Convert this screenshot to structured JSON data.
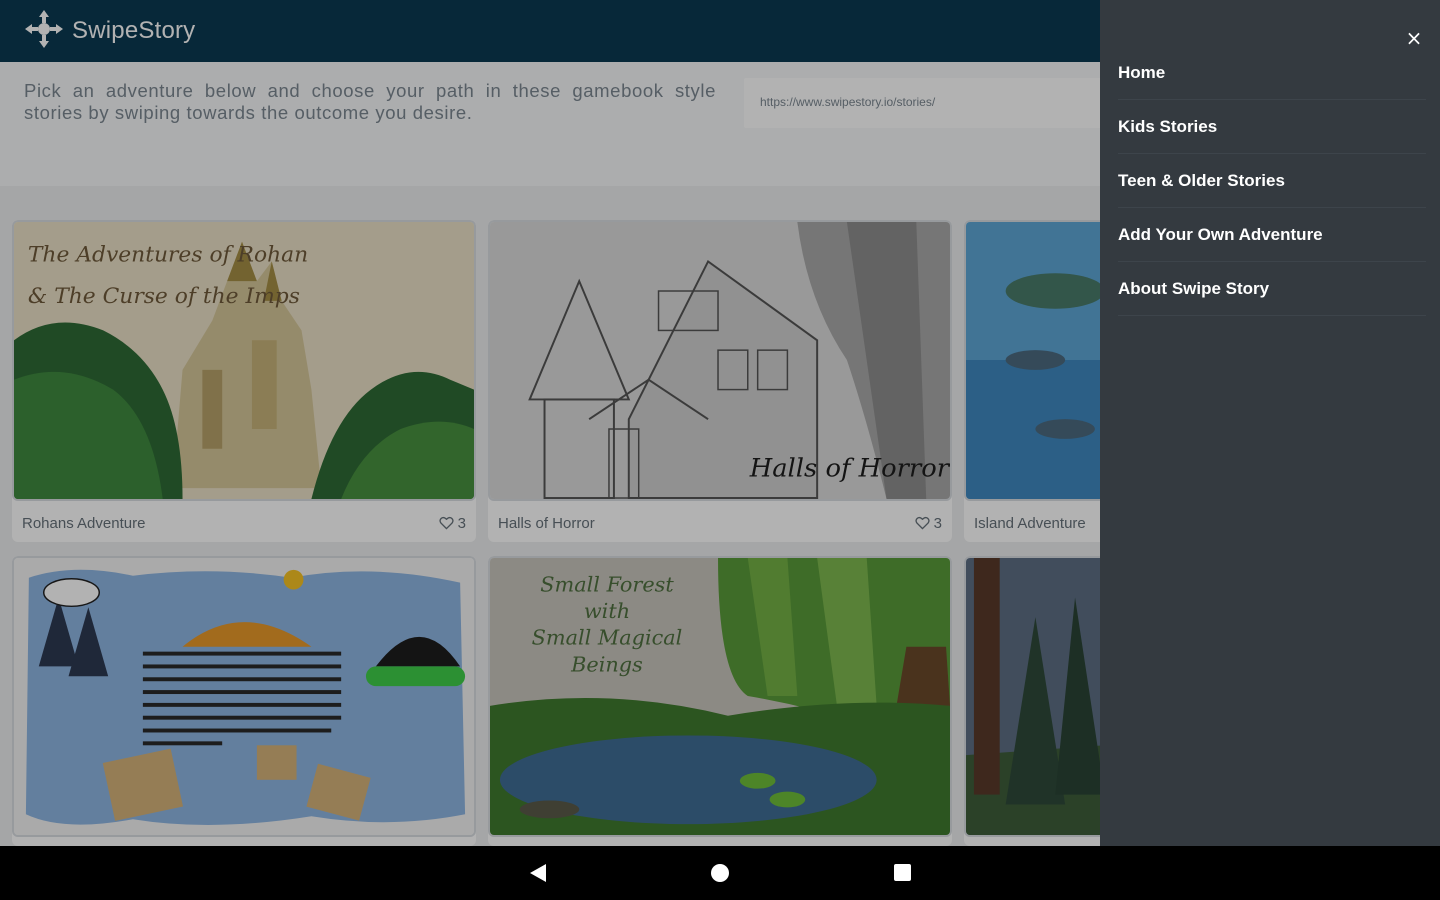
{
  "header": {
    "brand_name": "SwipeStory",
    "logo_icon": "four-arrows-cross-icon",
    "background": "#0b3a52"
  },
  "intro": {
    "description": "Pick an adventure below and choose your path in these gamebook style stories by swiping towards the outcome you desire.",
    "url": "https://www.swipestory.io/stories/"
  },
  "stories": [
    {
      "title": "Rohans Adventure",
      "likes": "3",
      "cover_text": [
        "The Adventures of Rohan",
        "& The Curse of the Imps"
      ]
    },
    {
      "title": "Halls of Horror",
      "likes": "3",
      "cover_text": [
        "Halls of Horror"
      ]
    },
    {
      "title": "Island Adventure",
      "likes": "",
      "cover_text": []
    },
    {
      "title": "",
      "likes": "",
      "cover_text": []
    },
    {
      "title": "",
      "likes": "",
      "cover_text": [
        "Small Forest",
        "with",
        "Small Magical",
        "Beings"
      ]
    },
    {
      "title": "",
      "likes": "",
      "cover_text": []
    }
  ],
  "drawer": {
    "close_label": "×",
    "items": [
      {
        "label": "Home"
      },
      {
        "label": "Kids Stories"
      },
      {
        "label": "Teen & Older Stories"
      },
      {
        "label": "Add Your Own Adventure"
      },
      {
        "label": "About Swipe Story"
      }
    ],
    "background": "#343a40"
  },
  "system_nav": {
    "back_icon": "back-triangle-icon",
    "home_icon": "home-circle-icon",
    "recents_icon": "recents-square-icon"
  }
}
